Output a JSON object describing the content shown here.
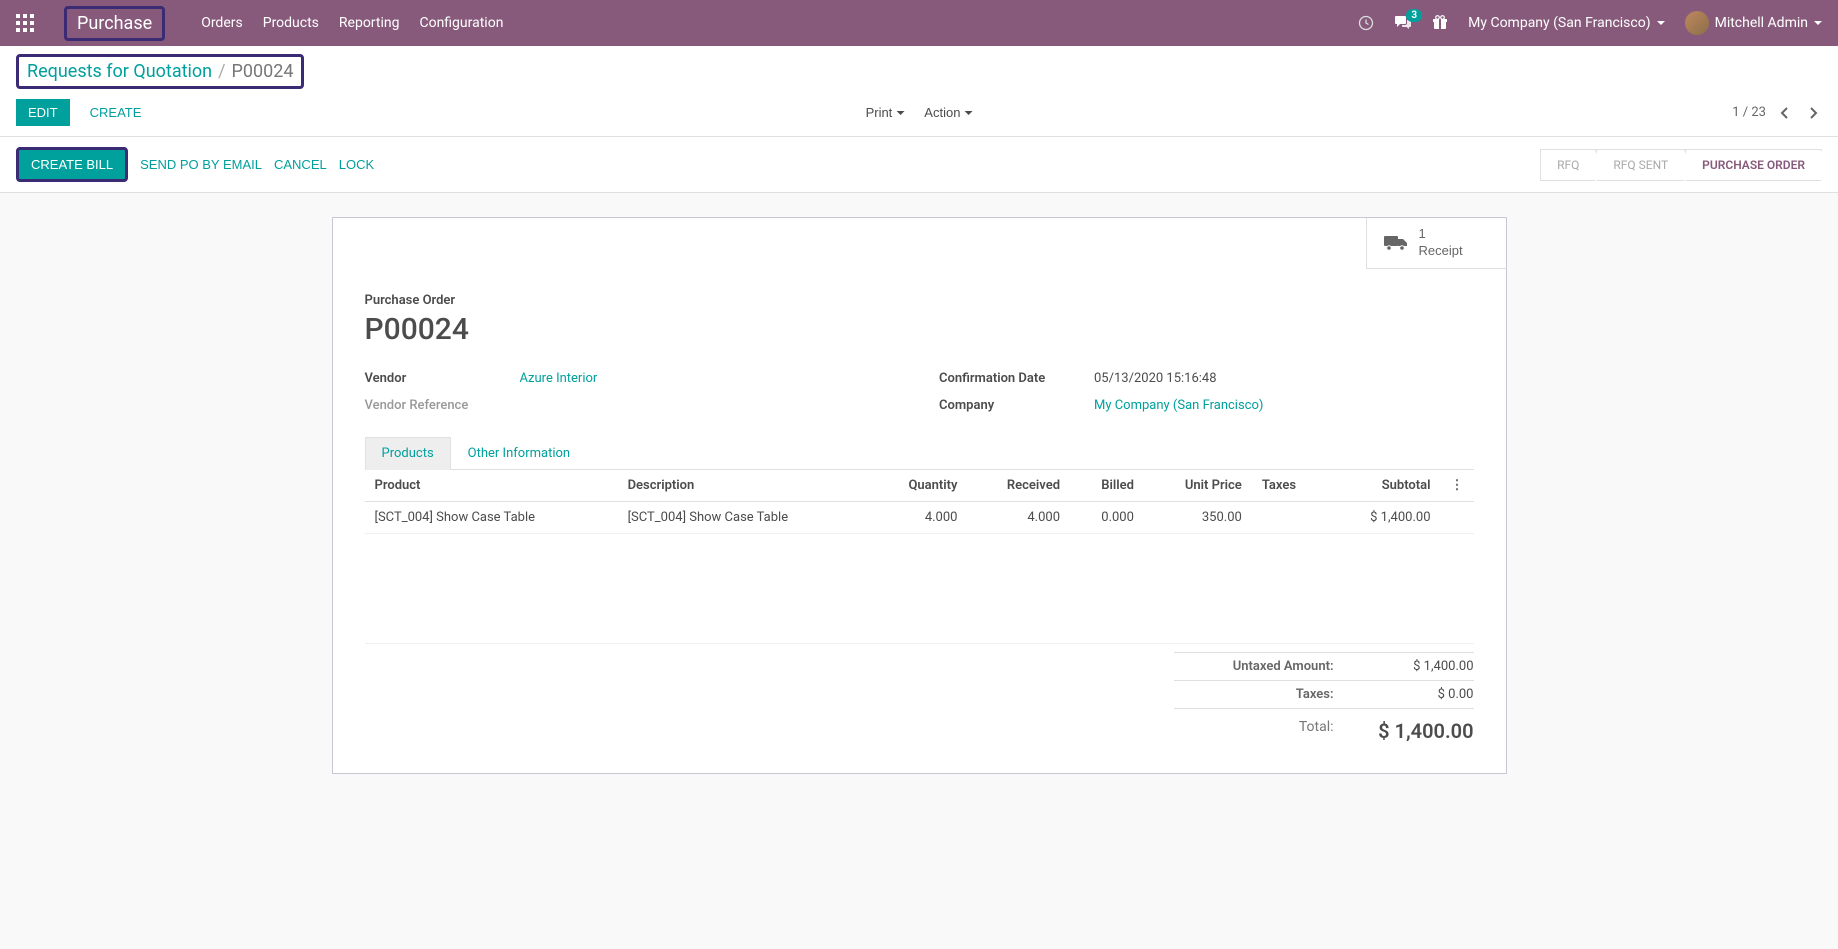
{
  "topnav": {
    "app_name": "Purchase",
    "menu": [
      "Orders",
      "Products",
      "Reporting",
      "Configuration"
    ],
    "chat_count": "3",
    "company": "My Company (San Francisco)",
    "user": "Mitchell Admin"
  },
  "breadcrumb": {
    "parent": "Requests for Quotation",
    "current": "P00024"
  },
  "buttons": {
    "edit": "Edit",
    "create": "Create",
    "print": "Print",
    "action": "Action",
    "create_bill": "Create Bill",
    "send_po": "Send PO by Email",
    "cancel": "Cancel",
    "lock": "Lock"
  },
  "pager": {
    "current": "1",
    "total": "23"
  },
  "status_steps": {
    "rfq": "RFQ",
    "rfq_sent": "RFQ Sent",
    "po": "Purchase Order"
  },
  "stat_button": {
    "count": "1",
    "label": "Receipt"
  },
  "form": {
    "title_label": "Purchase Order",
    "title": "P00024",
    "vendor_label": "Vendor",
    "vendor": "Azure Interior",
    "vendor_ref_label": "Vendor Reference",
    "vendor_ref": "",
    "conf_date_label": "Confirmation Date",
    "conf_date": "05/13/2020 15:16:48",
    "company_label": "Company",
    "company": "My Company (San Francisco)"
  },
  "tabs": {
    "products": "Products",
    "other": "Other Information"
  },
  "table": {
    "headers": {
      "product": "Product",
      "description": "Description",
      "quantity": "Quantity",
      "received": "Received",
      "billed": "Billed",
      "unit_price": "Unit Price",
      "taxes": "Taxes",
      "subtotal": "Subtotal"
    },
    "rows": [
      {
        "product": "[SCT_004] Show Case Table",
        "description": "[SCT_004] Show Case Table",
        "quantity": "4.000",
        "received": "4.000",
        "billed": "0.000",
        "unit_price": "350.00",
        "taxes": "",
        "subtotal": "$ 1,400.00"
      }
    ]
  },
  "totals": {
    "untaxed_label": "Untaxed Amount:",
    "untaxed": "$ 1,400.00",
    "taxes_label": "Taxes:",
    "taxes": "$ 0.00",
    "total_label": "Total:",
    "total": "$ 1,400.00"
  }
}
